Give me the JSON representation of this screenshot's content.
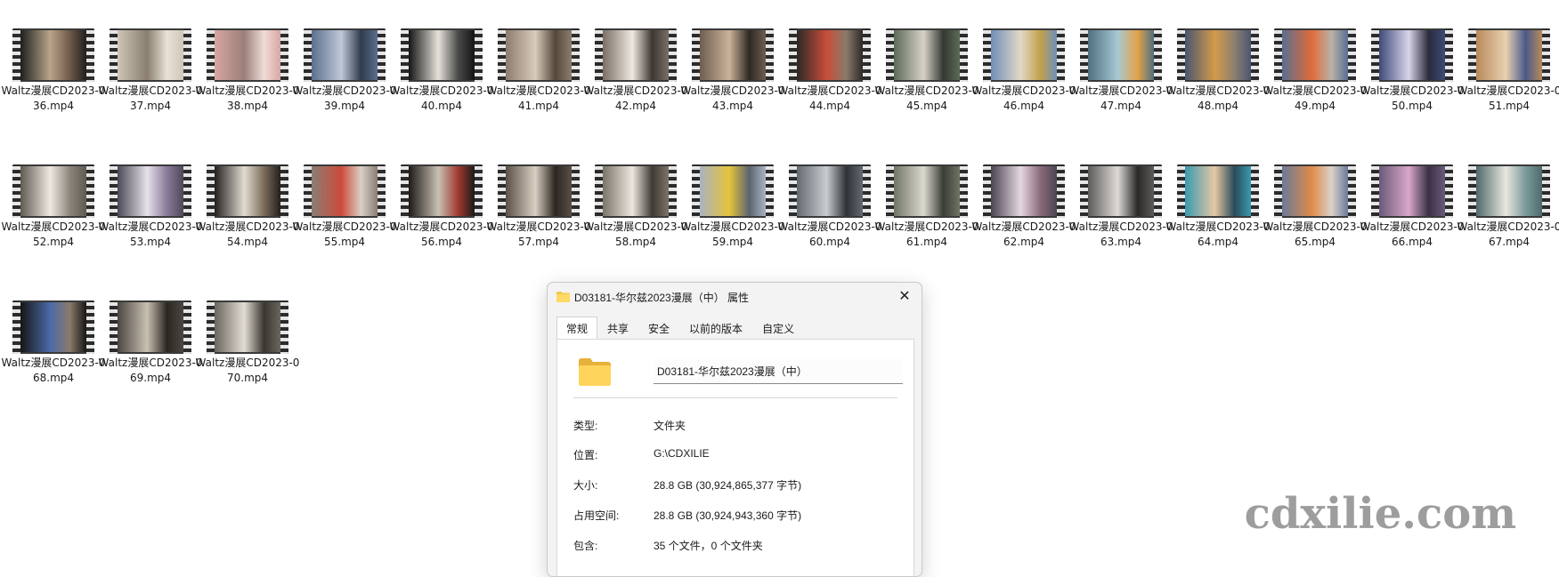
{
  "files": [
    {
      "name": "Waltz漫展CD2023-036.mp4",
      "thumb_colors": [
        "#1f1f1f",
        "#b9a58a",
        "#6e5a48"
      ]
    },
    {
      "name": "Waltz漫展CD2023-037.mp4",
      "thumb_colors": [
        "#cfc6b8",
        "#8a7e70",
        "#e9e2d6"
      ]
    },
    {
      "name": "Waltz漫展CD2023-038.mp4",
      "thumb_colors": [
        "#d8a6a2",
        "#9b7f7b",
        "#f0dcd6"
      ]
    },
    {
      "name": "Waltz漫展CD2023-039.mp4",
      "thumb_colors": [
        "#5c6f8f",
        "#bfc8d6",
        "#2f3a4c"
      ]
    },
    {
      "name": "Waltz漫展CD2023-040.mp4",
      "thumb_colors": [
        "#141414",
        "#e6e2da",
        "#4a4a4a"
      ]
    },
    {
      "name": "Waltz漫展CD2023-041.mp4",
      "thumb_colors": [
        "#8c7d6e",
        "#d9cbbb",
        "#55473b"
      ]
    },
    {
      "name": "Waltz漫展CD2023-042.mp4",
      "thumb_colors": [
        "#7a6f66",
        "#efe9e1",
        "#3c3631"
      ]
    },
    {
      "name": "Waltz漫展CD2023-043.mp4",
      "thumb_colors": [
        "#6e5e50",
        "#c9b39a",
        "#2e2823"
      ]
    },
    {
      "name": "Waltz漫展CD2023-044.mp4",
      "thumb_colors": [
        "#2c2926",
        "#c94d3a",
        "#8a7a6a"
      ]
    },
    {
      "name": "Waltz漫展CD2023-045.mp4",
      "thumb_colors": [
        "#5d6a58",
        "#d7d2c8",
        "#343832"
      ]
    },
    {
      "name": "Waltz漫展CD2023-046.mp4",
      "thumb_colors": [
        "#6f8fb8",
        "#e2d8c8",
        "#c2a14a"
      ]
    },
    {
      "name": "Waltz漫展CD2023-047.mp4",
      "thumb_colors": [
        "#4f6f7f",
        "#a7c9d4",
        "#e3a24a"
      ]
    },
    {
      "name": "Waltz漫展CD2023-048.mp4",
      "thumb_colors": [
        "#4a5670",
        "#d49a4a",
        "#8c8070"
      ]
    },
    {
      "name": "Waltz漫展CD2023-049.mp4",
      "thumb_colors": [
        "#5a6e92",
        "#e06b3a",
        "#b9b2a8"
      ]
    },
    {
      "name": "Waltz漫展CD2023-050.mp4",
      "thumb_colors": [
        "#3e4b78",
        "#d8d4ea",
        "#2a2a3a"
      ]
    },
    {
      "name": "Waltz漫展CD2023-051.mp4",
      "thumb_colors": [
        "#b88a5a",
        "#e8d0b0",
        "#4a5a8a"
      ]
    },
    {
      "name": "Waltz漫展CD2023-052.mp4",
      "thumb_colors": [
        "#5f5a52",
        "#efe9e2",
        "#8b857a"
      ]
    },
    {
      "name": "Waltz漫展CD2023-053.mp4",
      "thumb_colors": [
        "#4c4a56",
        "#e7e2ea",
        "#8a7a9a"
      ]
    },
    {
      "name": "Waltz漫展CD2023-054.mp4",
      "thumb_colors": [
        "#23201d",
        "#e1dcd2",
        "#7b6b5a"
      ]
    },
    {
      "name": "Waltz漫展CD2023-055.mp4",
      "thumb_colors": [
        "#8a7e74",
        "#cc4a3a",
        "#d9d0c4"
      ]
    },
    {
      "name": "Waltz漫展CD2023-056.mp4",
      "thumb_colors": [
        "#1c1a18",
        "#c8c0b4",
        "#a03a2e"
      ]
    },
    {
      "name": "Waltz漫展CD2023-057.mp4",
      "thumb_colors": [
        "#5a5046",
        "#d9cfc2",
        "#2b2622"
      ]
    },
    {
      "name": "Waltz漫展CD2023-058.mp4",
      "thumb_colors": [
        "#7c7468",
        "#ece7de",
        "#3f3a34"
      ]
    },
    {
      "name": "Waltz漫展CD2023-059.mp4",
      "thumb_colors": [
        "#aab3c0",
        "#e6c43a",
        "#5a6470"
      ]
    },
    {
      "name": "Waltz漫展CD2023-060.mp4",
      "thumb_colors": [
        "#636a70",
        "#c9ccd0",
        "#2e3236"
      ]
    },
    {
      "name": "Waltz漫展CD2023-061.mp4",
      "thumb_colors": [
        "#6f7565",
        "#dcd9cf",
        "#3a3d35"
      ]
    },
    {
      "name": "Waltz漫展CD2023-062.mp4",
      "thumb_colors": [
        "#4b4452",
        "#e5d8e0",
        "#8a6a7a"
      ]
    },
    {
      "name": "Waltz漫展CD2023-063.mp4",
      "thumb_colors": [
        "#5c5a58",
        "#dddad6",
        "#2a2928"
      ]
    },
    {
      "name": "Waltz漫展CD2023-064.mp4",
      "thumb_colors": [
        "#3a9ab0",
        "#e6c7a4",
        "#2a4a5a"
      ]
    },
    {
      "name": "Waltz漫展CD2023-065.mp4",
      "thumb_colors": [
        "#6a7a9a",
        "#e08a4a",
        "#d9d2c9"
      ]
    },
    {
      "name": "Waltz漫展CD2023-066.mp4",
      "thumb_colors": [
        "#6a5a7a",
        "#d9a6c9",
        "#3a3044"
      ]
    },
    {
      "name": "Waltz漫展CD2023-067.mp4",
      "thumb_colors": [
        "#4f6a6a",
        "#e9e6e0",
        "#7a9a9a"
      ]
    },
    {
      "name": "Waltz漫展CD2023-068.mp4",
      "thumb_colors": [
        "#161616",
        "#4a6aa8",
        "#8a7a6a"
      ]
    },
    {
      "name": "Waltz漫展CD2023-069.mp4",
      "thumb_colors": [
        "#4a4640",
        "#c9c0b2",
        "#2a2723"
      ]
    },
    {
      "name": "Waltz漫展CD2023-070.mp4",
      "thumb_colors": [
        "#6a665e",
        "#e2ddd4",
        "#3a3732"
      ]
    }
  ],
  "dialog": {
    "title": "D03181-华尔兹2023漫展（中） 属性",
    "close_glyph": "✕",
    "tabs": [
      {
        "label": "常规",
        "active": true
      },
      {
        "label": "共享",
        "active": false
      },
      {
        "label": "安全",
        "active": false
      },
      {
        "label": "以前的版本",
        "active": false
      },
      {
        "label": "自定义",
        "active": false
      }
    ],
    "folder_name": "D03181-华尔兹2023漫展（中）",
    "props": [
      {
        "label": "类型:",
        "value": "文件夹"
      },
      {
        "label": "位置:",
        "value": "G:\\CDXILIE"
      },
      {
        "label": "大小:",
        "value": "28.8 GB (30,924,865,377 字节)"
      },
      {
        "label": "占用空间:",
        "value": "28.8 GB (30,924,943,360 字节)"
      },
      {
        "label": "包含:",
        "value": "35 个文件，0 个文件夹"
      }
    ],
    "folder_color": "#f2c94c"
  },
  "watermark": "cdxilie.com"
}
